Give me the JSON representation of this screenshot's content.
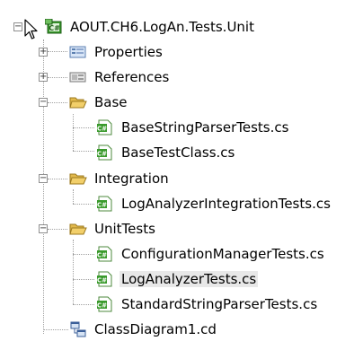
{
  "tree": {
    "root": {
      "label": "AOUT.CH6.LogAn.Tests.Unit",
      "icon": "csharp-project-icon",
      "expanded": true
    },
    "items": [
      {
        "label": "Properties",
        "icon": "properties-icon",
        "level": 1,
        "expandable": true,
        "expanded": false
      },
      {
        "label": "References",
        "icon": "references-icon",
        "level": 1,
        "expandable": true,
        "expanded": false
      },
      {
        "label": "Base",
        "icon": "folder-open-icon",
        "level": 1,
        "expandable": true,
        "expanded": true
      },
      {
        "label": "BaseStringParserTests.cs",
        "icon": "csharp-file-icon",
        "level": 2
      },
      {
        "label": "BaseTestClass.cs",
        "icon": "csharp-file-icon",
        "level": 2
      },
      {
        "label": "Integration",
        "icon": "folder-open-icon",
        "level": 1,
        "expandable": true,
        "expanded": true
      },
      {
        "label": "LogAnalyzerIntegrationTests.cs",
        "icon": "csharp-file-icon",
        "level": 2
      },
      {
        "label": "UnitTests",
        "icon": "folder-open-icon",
        "level": 1,
        "expandable": true,
        "expanded": true
      },
      {
        "label": "ConfigurationManagerTests.cs",
        "icon": "csharp-file-icon",
        "level": 2
      },
      {
        "label": "LogAnalyzerTests.cs",
        "icon": "csharp-file-icon",
        "level": 2,
        "selected": true
      },
      {
        "label": "StandardStringParserTests.cs",
        "icon": "csharp-file-icon",
        "level": 2
      },
      {
        "label": "ClassDiagram1.cd",
        "icon": "class-diagram-icon",
        "level": 1
      }
    ]
  },
  "colors": {
    "selection": "#e8e8e8",
    "folder": "#f2cf6a",
    "project_green": "#3a9a2c",
    "guide_line": "#a0a0a0"
  }
}
